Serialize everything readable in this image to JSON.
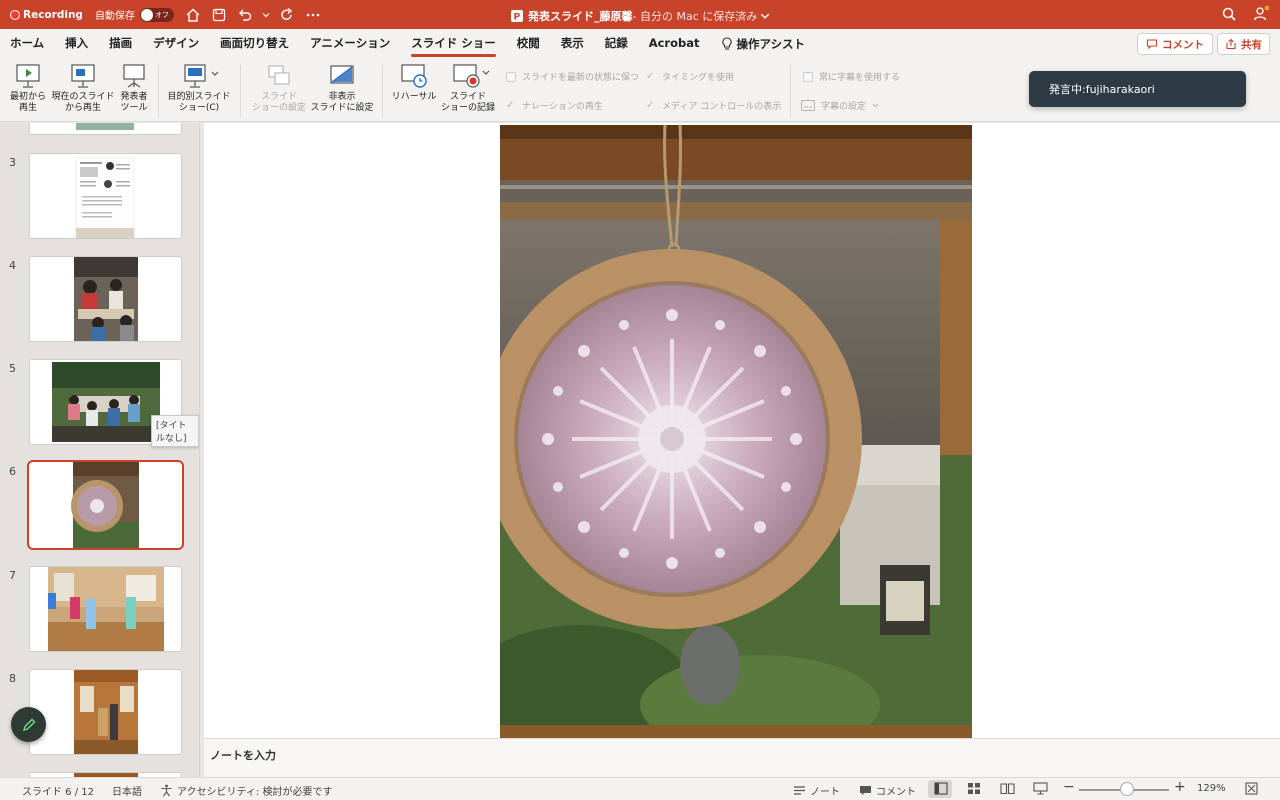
{
  "recording": {
    "label": "Recording"
  },
  "titlebar": {
    "autosave_label": "自動保存",
    "autosave_state": "オフ",
    "doc_name": "発表スライド_藤原馨",
    "doc_location": " - 自分の Mac に保存済み"
  },
  "tabs": [
    {
      "label": "ホーム"
    },
    {
      "label": "挿入"
    },
    {
      "label": "描画"
    },
    {
      "label": "デザイン"
    },
    {
      "label": "画面切り替え"
    },
    {
      "label": "アニメーション"
    },
    {
      "label": "スライド ショー",
      "active": true
    },
    {
      "label": "校閲"
    },
    {
      "label": "表示"
    },
    {
      "label": "記録"
    },
    {
      "label": "Acrobat"
    },
    {
      "label": "操作アシスト"
    }
  ],
  "header_buttons": {
    "comment": "コメント",
    "share": "共有"
  },
  "ribbon": {
    "from_start_1": "最初から",
    "from_start_2": "再生",
    "from_current_1": "現在のスライド",
    "from_current_2": "から再生",
    "presenter_1": "発表者",
    "presenter_2": "ツール",
    "custom_1": "目的別スライド",
    "custom_2": "ショー(C)",
    "setup_1": "スライド",
    "setup_2": "ショーの設定",
    "hide_1": "非表示",
    "hide_2": "スライドに設定",
    "rehearse": "リハーサル",
    "record_1": "スライド",
    "record_2": "ショーの記録",
    "chk_keep_updated": "スライドを最新の状態に保つ",
    "chk_timings": "タイミングを使用",
    "chk_narration": "ナレーションの再生",
    "chk_media": "メディア コントロールの表示",
    "chk_subtitles": "常に字幕を使用する",
    "subtitle_settings": "字幕の設定"
  },
  "toast": {
    "text": "発言中:fujiharakaori"
  },
  "thumbnails": [
    {
      "num": "3"
    },
    {
      "num": "4"
    },
    {
      "num": "5"
    },
    {
      "num": "6"
    },
    {
      "num": "7"
    },
    {
      "num": "8"
    }
  ],
  "tooltip": "[タイトルなし]",
  "notes": {
    "placeholder": "ノートを入力"
  },
  "status": {
    "slide": "スライド 6 / 12",
    "language": "日本語",
    "accessibility": "アクセシビリティ: 検討が必要です",
    "notes": "ノート",
    "comments": "コメント",
    "zoom": "129%"
  },
  "colors": {
    "accent": "#c8432a",
    "titlebar": "#c8432a",
    "toast": "#2e3b45"
  }
}
